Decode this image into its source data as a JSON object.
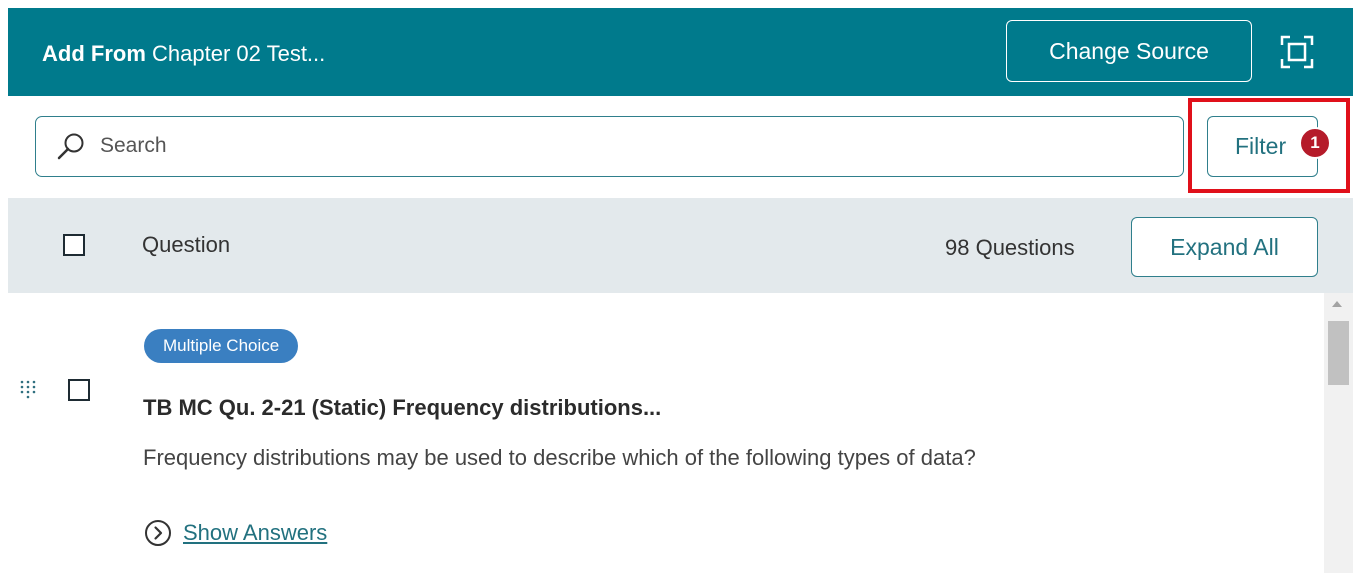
{
  "header": {
    "title_prefix": "Add From",
    "title_source": "Chapter 02 Test...",
    "change_source_label": "Change Source",
    "fullscreen_icon": "fullscreen-icon"
  },
  "search": {
    "placeholder": "Search",
    "value": ""
  },
  "filter": {
    "label": "Filter",
    "badge_count": "1"
  },
  "list_header": {
    "column_label": "Question",
    "count_text": "98 Questions",
    "expand_all_label": "Expand All"
  },
  "questions": [
    {
      "type": "Multiple Choice",
      "title": "TB MC Qu. 2-21 (Static) Frequency distributions...",
      "text": "Frequency distributions may be used to describe which of the following types of data?",
      "show_answers_label": "Show Answers"
    }
  ],
  "colors": {
    "header_bg": "#007a8c",
    "accent": "#22717f",
    "badge_blue": "#3a7fc1",
    "filter_badge": "#b51b2a",
    "highlight": "#e0101a"
  }
}
